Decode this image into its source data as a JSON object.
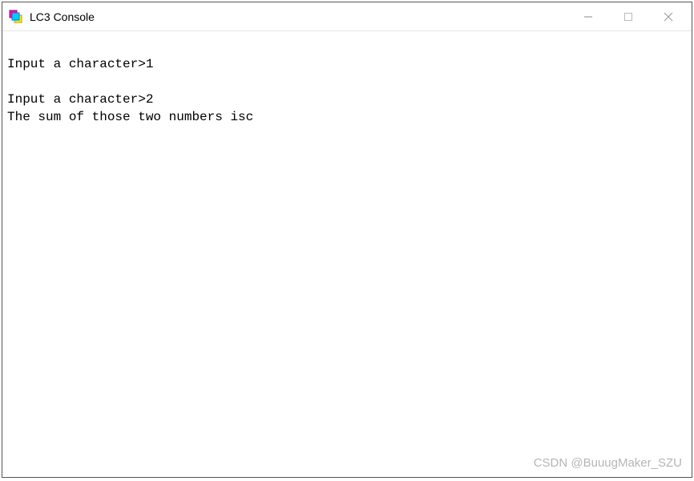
{
  "window": {
    "title": "LC3 Console"
  },
  "console": {
    "lines": [
      "",
      "Input a character>1",
      "",
      "Input a character>2",
      "The sum of those two numbers isc"
    ]
  },
  "watermark": "CSDN @BuuugMaker_SZU"
}
